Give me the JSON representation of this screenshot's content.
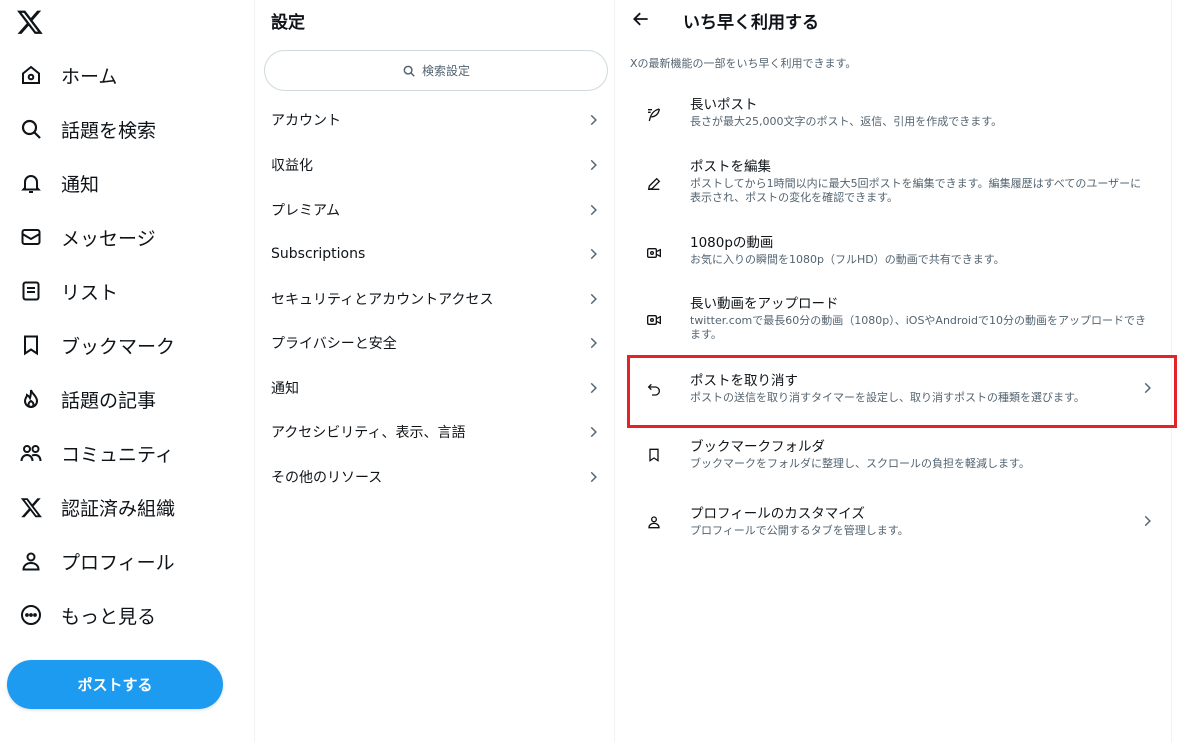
{
  "nav": {
    "items": [
      {
        "label": "ホーム",
        "icon": "home-icon"
      },
      {
        "label": "話題を検索",
        "icon": "search-icon"
      },
      {
        "label": "通知",
        "icon": "bell-icon"
      },
      {
        "label": "メッセージ",
        "icon": "envelope-icon"
      },
      {
        "label": "リスト",
        "icon": "list-icon"
      },
      {
        "label": "ブックマーク",
        "icon": "bookmark-icon"
      },
      {
        "label": "話題の記事",
        "icon": "flame-icon"
      },
      {
        "label": "コミュニティ",
        "icon": "people-icon"
      },
      {
        "label": "認証済み組織",
        "icon": "x-logo-icon"
      },
      {
        "label": "プロフィール",
        "icon": "person-icon"
      },
      {
        "label": "もっと見る",
        "icon": "more-circle-icon"
      }
    ],
    "post_button": "ポストする"
  },
  "settings": {
    "title": "設定",
    "search_placeholder": "検索設定",
    "items": [
      {
        "label": "アカウント"
      },
      {
        "label": "収益化"
      },
      {
        "label": "プレミアム"
      },
      {
        "label": "Subscriptions"
      },
      {
        "label": "セキュリティとアカウントアクセス"
      },
      {
        "label": "プライバシーと安全"
      },
      {
        "label": "通知"
      },
      {
        "label": "アクセシビリティ、表示、言語"
      },
      {
        "label": "その他のリソース"
      }
    ]
  },
  "main": {
    "title": "いち早く利用する",
    "description": "Xの最新機能の一部をいち早く利用できます。",
    "features": [
      {
        "title": "長いポスト",
        "desc": "長さが最大25,000文字のポスト、返信、引用を作成できます。",
        "icon": "quill-icon",
        "chevron": false
      },
      {
        "title": "ポストを編集",
        "desc": "ポストしてから1時間以内に最大5回ポストを編集できます。編集履歴はすべてのユーザーに表示され、ポストの変化を確認できます。",
        "icon": "pencil-icon",
        "chevron": false
      },
      {
        "title": "1080pの動画",
        "desc": "お気に入りの瞬間を1080p（フルHD）の動画で共有できます。",
        "icon": "video-icon",
        "chevron": false
      },
      {
        "title": "長い動画をアップロード",
        "desc": "twitter.comで最長60分の動画（1080p）、iOSやAndroidで10分の動画をアップロードできます。",
        "icon": "video-icon",
        "chevron": false
      },
      {
        "title": "ポストを取り消す",
        "desc": "ポストの送信を取り消すタイマーを設定し、取り消すポストの種類を選びます。",
        "icon": "undo-icon",
        "chevron": true
      },
      {
        "title": "ブックマークフォルダ",
        "desc": "ブックマークをフォルダに整理し、スクロールの負担を軽減します。",
        "icon": "bookmark-icon",
        "chevron": false
      },
      {
        "title": "プロフィールのカスタマイズ",
        "desc": "プロフィールで公開するタブを管理します。",
        "icon": "person-icon",
        "chevron": true
      }
    ]
  },
  "colors": {
    "accent": "#1d9bf0",
    "highlight": "#e3222a",
    "secondary_text": "#536471"
  }
}
